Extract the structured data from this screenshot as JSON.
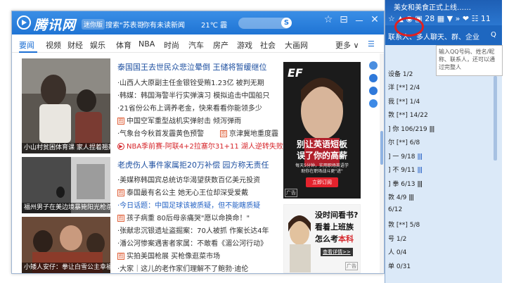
{
  "news_window": {
    "logo_text": "腾讯网",
    "logo_sub": "迷你版",
    "search_hint": "搜索\"苏表哥",
    "unread_text": "你有未读新闻",
    "weather": "21℃ 霾",
    "search_btn": "S",
    "btn_pin": "☆",
    "btn_skin": "⊟",
    "btn_min": "－",
    "btn_close": "✕",
    "nav": [
      "要闻",
      "视频",
      "财经",
      "娱乐",
      "体育",
      "NBA",
      "时尚",
      "汽车",
      "房产",
      "游戏",
      "社会",
      "大画网"
    ],
    "nav_more": "更多 ∨",
    "nav_menu": "☰",
    "blocks": [
      {
        "caption": "小山村贫困体育课 家人捏着翘翘",
        "headline": "泰国国王去世民众悲泣晕倒 王储将暂缓继位",
        "lines": [
          "·山西人大原副主任金银铨受贿1.23亿 被判无期",
          "·韩媒：韩国海警半行实弹演习 模拟追击中国船只",
          "·21省份公布上调养老金，快来看看你能领多少",
          "中国空军重型战机实弹射击 倾泻弹雨",
          "·气象台今秋首发霾黄色预警",
          "京津冀地重度霾",
          "NBA季前赛-阿联4+2拉塞尔31+11 湖人逆转失败"
        ]
      },
      {
        "caption": "福州男子在美边境暴毙阳光枪杀",
        "headline": "老虎伤人事件家属拒20万补偿 园方称无责任",
        "lines": [
          "·美媒称韩国宾总统访华渴望获数百亿美元投资",
          "泰国最有名公主 她无心王位却深受爱戴",
          "·今日话题：中国足球该被质疑，但不能瞎质疑",
          "孩子病重 80后母亲痛哭\"愿以命换命！\""
        ]
      },
      {
        "caption": "小矮人安仔：拳让白雪公主幸福",
        "lines": [
          "·张献忠沉银遗址盗掘案：70人被抓 作案长达4年",
          "·潘公河惨案遇害者家属：不敢看《湄公河行动》",
          "实拍美国枪展 买枪像逛菜市场",
          "·大家｜这儿的老作家们理解不了鲍勃·迪伦"
        ]
      }
    ],
    "ad1": {
      "logo": "EF",
      "title_line1": "别让英语短板",
      "title_line2": "误了你的高薪",
      "sub": "每天5分钟，实用职场英语学\n助你在职场战斗更\"进\"",
      "button": "立即订阅",
      "tag": "广告"
    },
    "ad2": {
      "line1": "没时间看书?",
      "line2": "看着上班族",
      "line3_a": "怎么考",
      "line3_b": "本科",
      "more": "查看详情>>",
      "tag": "广告"
    }
  },
  "qq_panel": {
    "title": "美女和美食正式上线……",
    "toolbar_icons": "☆ ▲ ◉ ▣ 28 ▦ ▼ » ❤ ☷ 11",
    "tabs": [
      "联系人、多人聊天、群、企业",
      "Q"
    ],
    "tip": "输入QQ号码、姓名/昵称、联系人，还可以通过完整人",
    "rows": [
      {
        "label": "设备 1/2"
      },
      {
        "label": "洋 [**]  2/4"
      },
      {
        "label": "我 [**]  1/4"
      },
      {
        "label": "敦 [**]  14/22"
      },
      {
        "label": "] 你  106/219",
        "bars": "|||"
      },
      {
        "label": "尔 [**]  6/8"
      },
      {
        "label": "] 一  9/18",
        "bars": "|||"
      },
      {
        "label": "] 不  9/11",
        "bars": "|||"
      },
      {
        "label": "] 拳  6/13",
        "bars": "|||"
      },
      {
        "label": "敦  4/9",
        "bars": "|||"
      },
      {
        "label": "6/12"
      },
      {
        "label": "敦 [**]  5/8"
      },
      {
        "label": "号 1/2"
      },
      {
        "label": "人 0/4"
      },
      {
        "label": "单 0/31"
      }
    ]
  }
}
